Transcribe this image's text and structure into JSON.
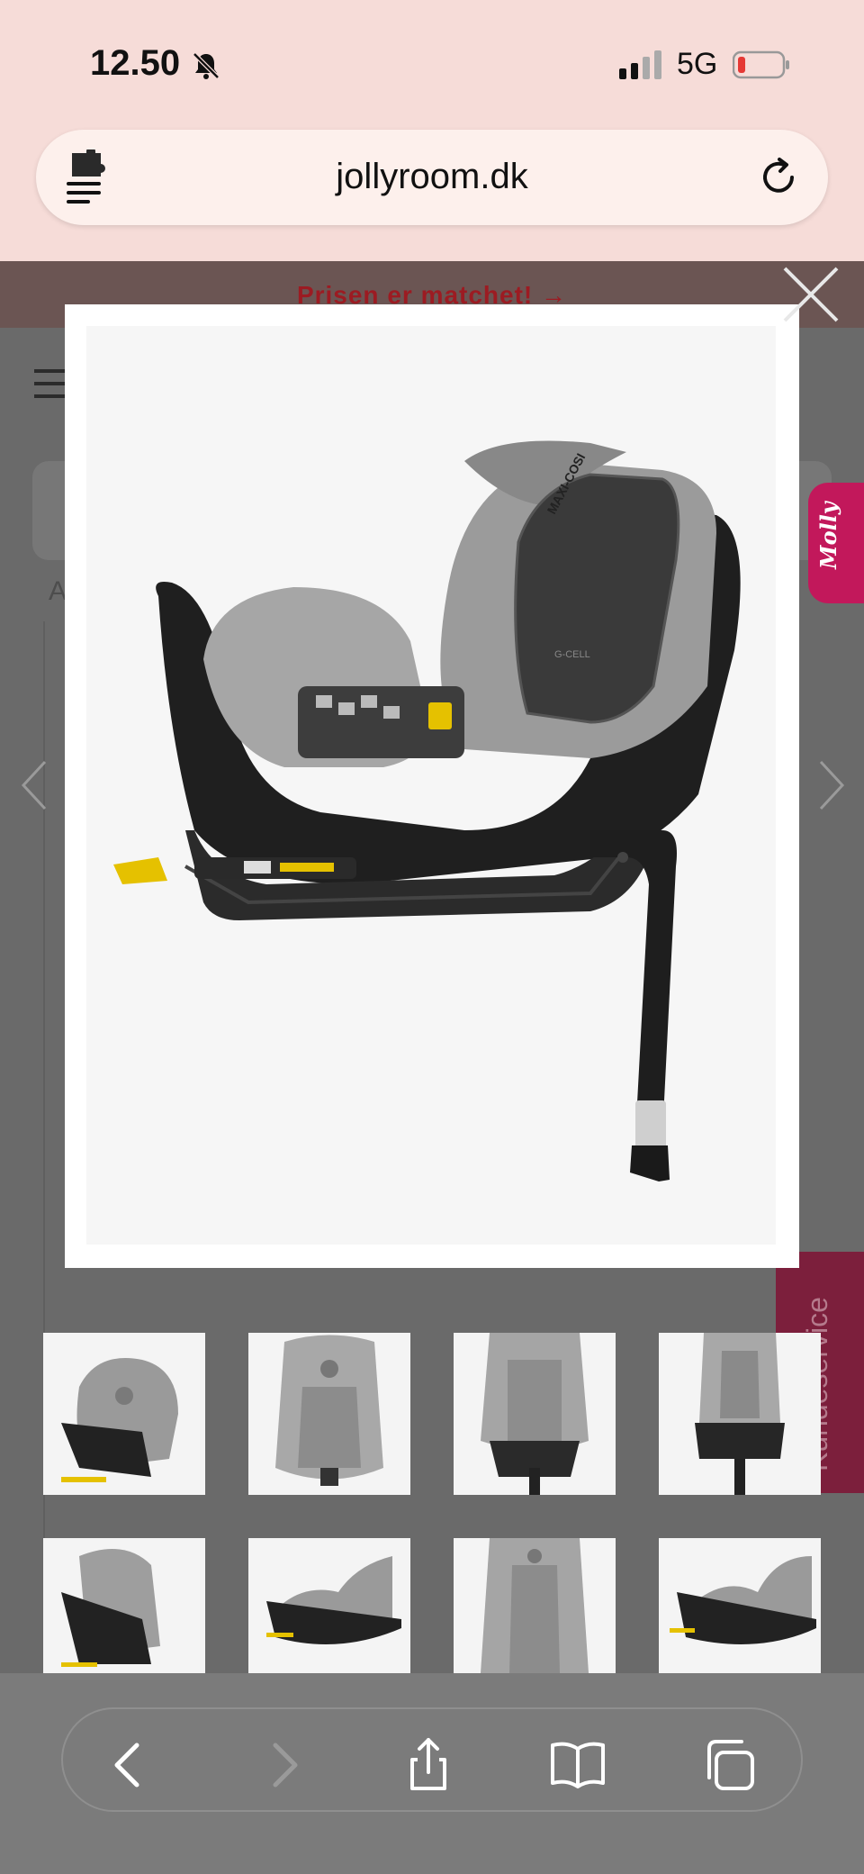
{
  "status_bar": {
    "time": "12.50",
    "network": "5G",
    "icons": [
      "bell-muted-icon",
      "signal-icon",
      "battery-low-icon"
    ]
  },
  "browser": {
    "url": "jollyroom.dk",
    "icons": [
      "extension-icon",
      "reload-icon"
    ]
  },
  "page": {
    "promo_banner": "Prisen er matchet! →",
    "ghost_letter": "A",
    "chat_tab": "Molly",
    "service_tab": "Kundeservice"
  },
  "gallery": {
    "main_image_alt": "Maxi-Cosi car seat with base, side view",
    "seat_brand_text": "MAXI-COSI",
    "seat_logo_text": "G-CELL",
    "thumbnails": [
      {
        "view": "angled-front"
      },
      {
        "view": "front-headrest"
      },
      {
        "view": "front-harness"
      },
      {
        "view": "front-base"
      },
      {
        "view": "side-left"
      },
      {
        "view": "side-reclined"
      },
      {
        "view": "front-close"
      },
      {
        "view": "side-base"
      }
    ]
  },
  "toolbar": {
    "buttons": [
      "back",
      "forward",
      "share",
      "bookmarks",
      "tabs"
    ]
  },
  "colors": {
    "status_bg": "#f6dcd8",
    "banner_text": "#9c1b22",
    "molly_tab": "#c2185b",
    "service_tab": "#7c1f3c",
    "battery_low": "#e53935"
  }
}
